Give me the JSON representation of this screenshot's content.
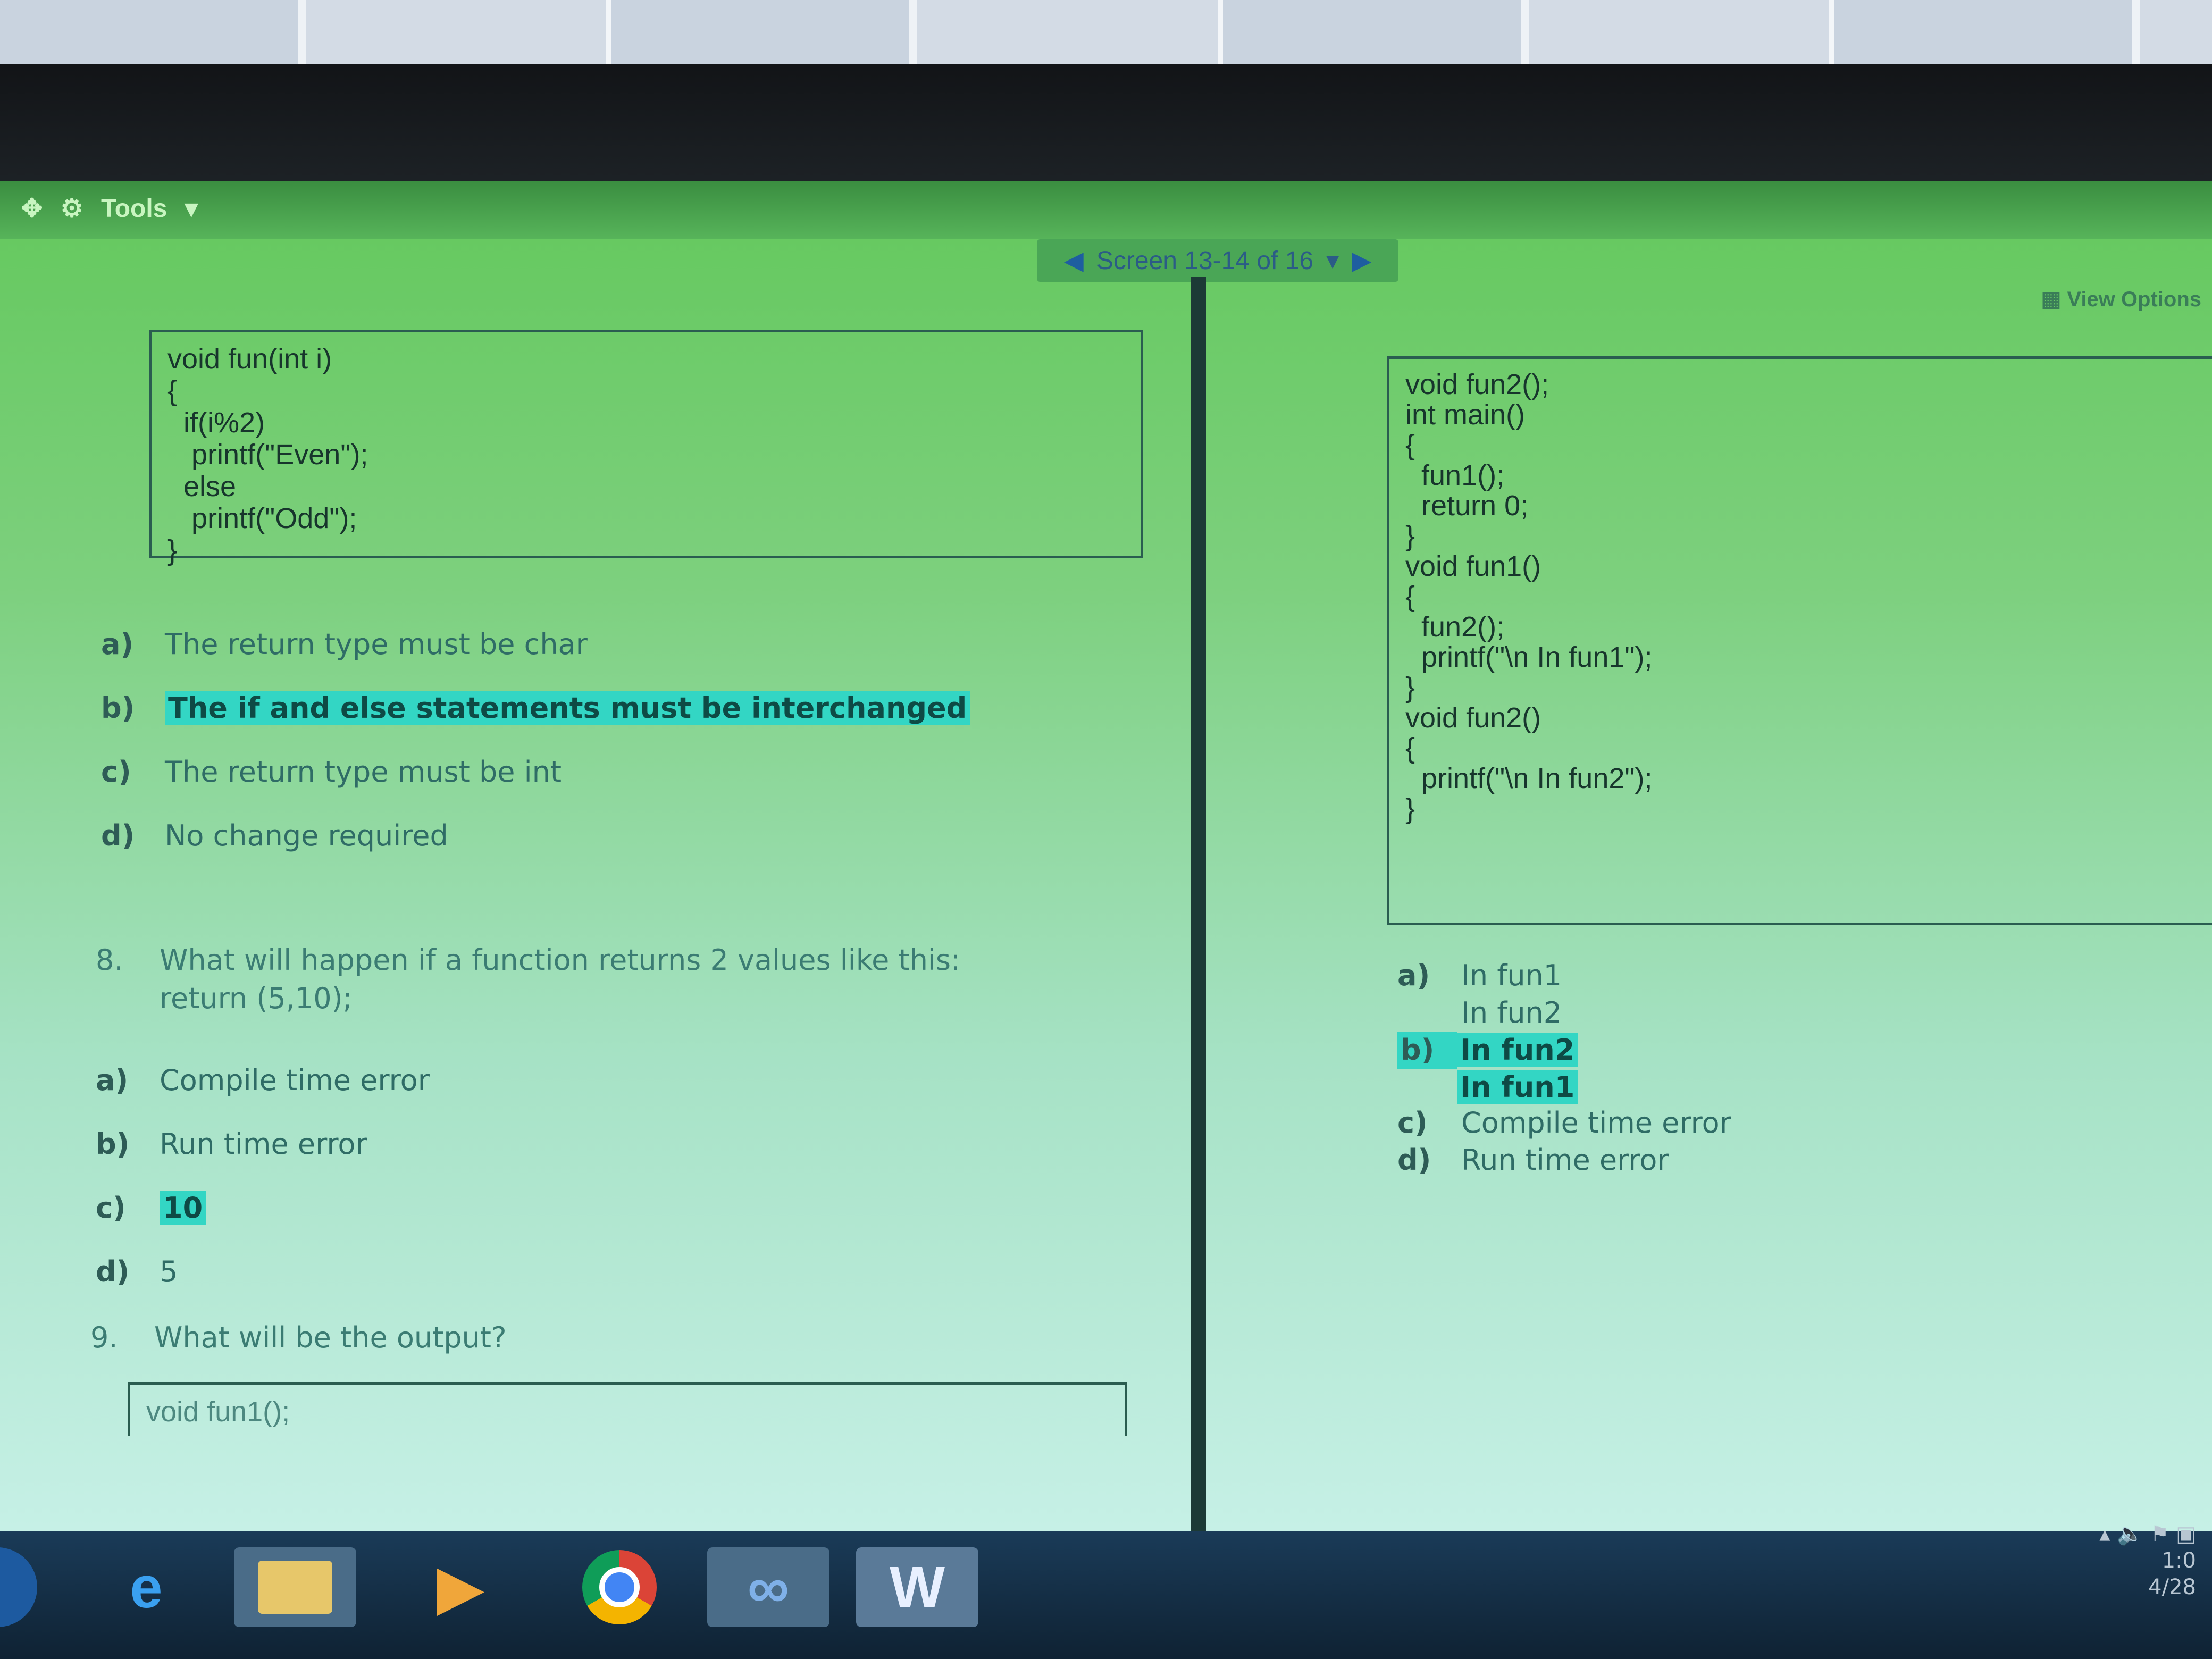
{
  "toolbar": {
    "tools_label": "Tools",
    "tools_arrow": "▾"
  },
  "nav": {
    "screen_label": "Screen 13-14 of 16",
    "prev_arrow": "◀",
    "next_arrow": "▶",
    "dropdown_arrow": "▾"
  },
  "view_options": {
    "label": "View Options"
  },
  "left": {
    "code1": [
      "void fun(int i)",
      "{",
      "  if(i%2)",
      "   printf(\"Even\");",
      "  else",
      "   printf(\"Odd\");",
      "}"
    ],
    "q7_options": [
      {
        "letter": "a)",
        "text": "The return type must be char"
      },
      {
        "letter": "b)",
        "text": "The if and else statements must be interchanged",
        "selected": true
      },
      {
        "letter": "c)",
        "text": "The return type must be int"
      },
      {
        "letter": "d)",
        "text": "No change required"
      }
    ],
    "q8": {
      "number": "8.",
      "line1": "What will happen if a function returns 2 values like this:",
      "line2": "return (5,10);",
      "options": [
        {
          "letter": "a)",
          "text": "Compile time error"
        },
        {
          "letter": "b)",
          "text": "Run time error"
        },
        {
          "letter": "c)",
          "text": "10",
          "selected": true
        },
        {
          "letter": "d)",
          "text": "5"
        }
      ]
    },
    "q9": {
      "number": "9.",
      "text": "What will be the output?",
      "code_first_line": "void fun1();"
    }
  },
  "right": {
    "code": [
      "void fun2();",
      "",
      "int main()",
      "{",
      "  fun1();",
      "  return 0;",
      "}",
      "",
      "void fun1()",
      "{",
      "  fun2();",
      "  printf(\"\\n In fun1\");",
      "}",
      "",
      "void fun2()",
      "{",
      "  printf(\"\\n In fun2\");",
      "}"
    ],
    "options": [
      {
        "letter": "a)",
        "line1": "In fun1",
        "line2": "In fun2"
      },
      {
        "letter": "b)",
        "line1": "In fun2",
        "line2": "In fun1",
        "selected": true
      },
      {
        "letter": "c)",
        "line1": "Compile time error"
      },
      {
        "letter": "d)",
        "line1": "Run time error"
      }
    ]
  },
  "taskbar": {
    "icons": [
      "internet-explorer-icon",
      "file-explorer-icon",
      "media-player-icon",
      "chrome-icon",
      "app-icon",
      "word-icon"
    ],
    "ie_glyph": "e",
    "word_glyph": "W",
    "media_glyph": "▶"
  },
  "tray": {
    "time": "1:0",
    "date": "4/28"
  },
  "colors": {
    "highlight": "#33d6c4",
    "screen_green": "#63c85c"
  }
}
